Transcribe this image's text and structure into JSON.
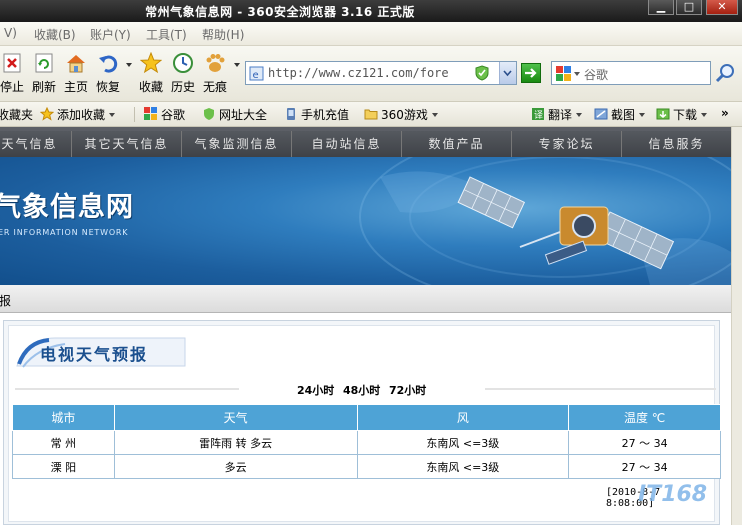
{
  "window": {
    "title": "常州气象信息网 - 360安全浏览器 3.16 正式版"
  },
  "menu": [
    "V)",
    "收藏(B)",
    "账户(Y)",
    "工具(T)",
    "帮助(H)"
  ],
  "toolbar": {
    "stop": "停止",
    "refresh": "刷新",
    "home": "主页",
    "restore": "恢复",
    "favorites": "收藏",
    "history": "历史",
    "incognito": "无痕"
  },
  "address": {
    "url": "http://www.cz121.com/fore"
  },
  "search": {
    "placeholder": "谷歌"
  },
  "favbar": {
    "folder": "收藏夹",
    "add": "添加收藏",
    "google": "谷歌",
    "directory": "网址大全",
    "mobile": "手机充值",
    "games": "360游戏",
    "translate": "翻译",
    "screenshot": "截图",
    "download": "下载"
  },
  "site": {
    "nav": [
      "天气信息",
      "其它天气信息",
      "气象监测信息",
      "自动站信息",
      "数值产品",
      "专家论坛",
      "信息服务"
    ],
    "brand": "气象信息网",
    "brand_en": "ER INFORMATION NETWORK",
    "crumb": "报"
  },
  "forecast": {
    "title": "电视天气预报",
    "tabs": [
      "24小时",
      "48小时",
      "72小时"
    ],
    "headers": [
      "城市",
      "天气",
      "风",
      "温度 ℃"
    ],
    "rows": [
      {
        "city": "常 州",
        "weather": "雷阵雨 转 多云",
        "wind": "东南风 <=3级",
        "temp": "27 ～ 34"
      },
      {
        "city": "溧 阳",
        "weather": "多云",
        "wind": "东南风 <=3级",
        "temp": "27 ～ 34"
      }
    ],
    "timestamp": "[2010-8-7 8:08:00]"
  },
  "watermark": "IT168",
  "colors": {
    "nav_bg": "#4a4d52",
    "table_header": "#4ea3d6",
    "banner": "#2f7dbe"
  }
}
